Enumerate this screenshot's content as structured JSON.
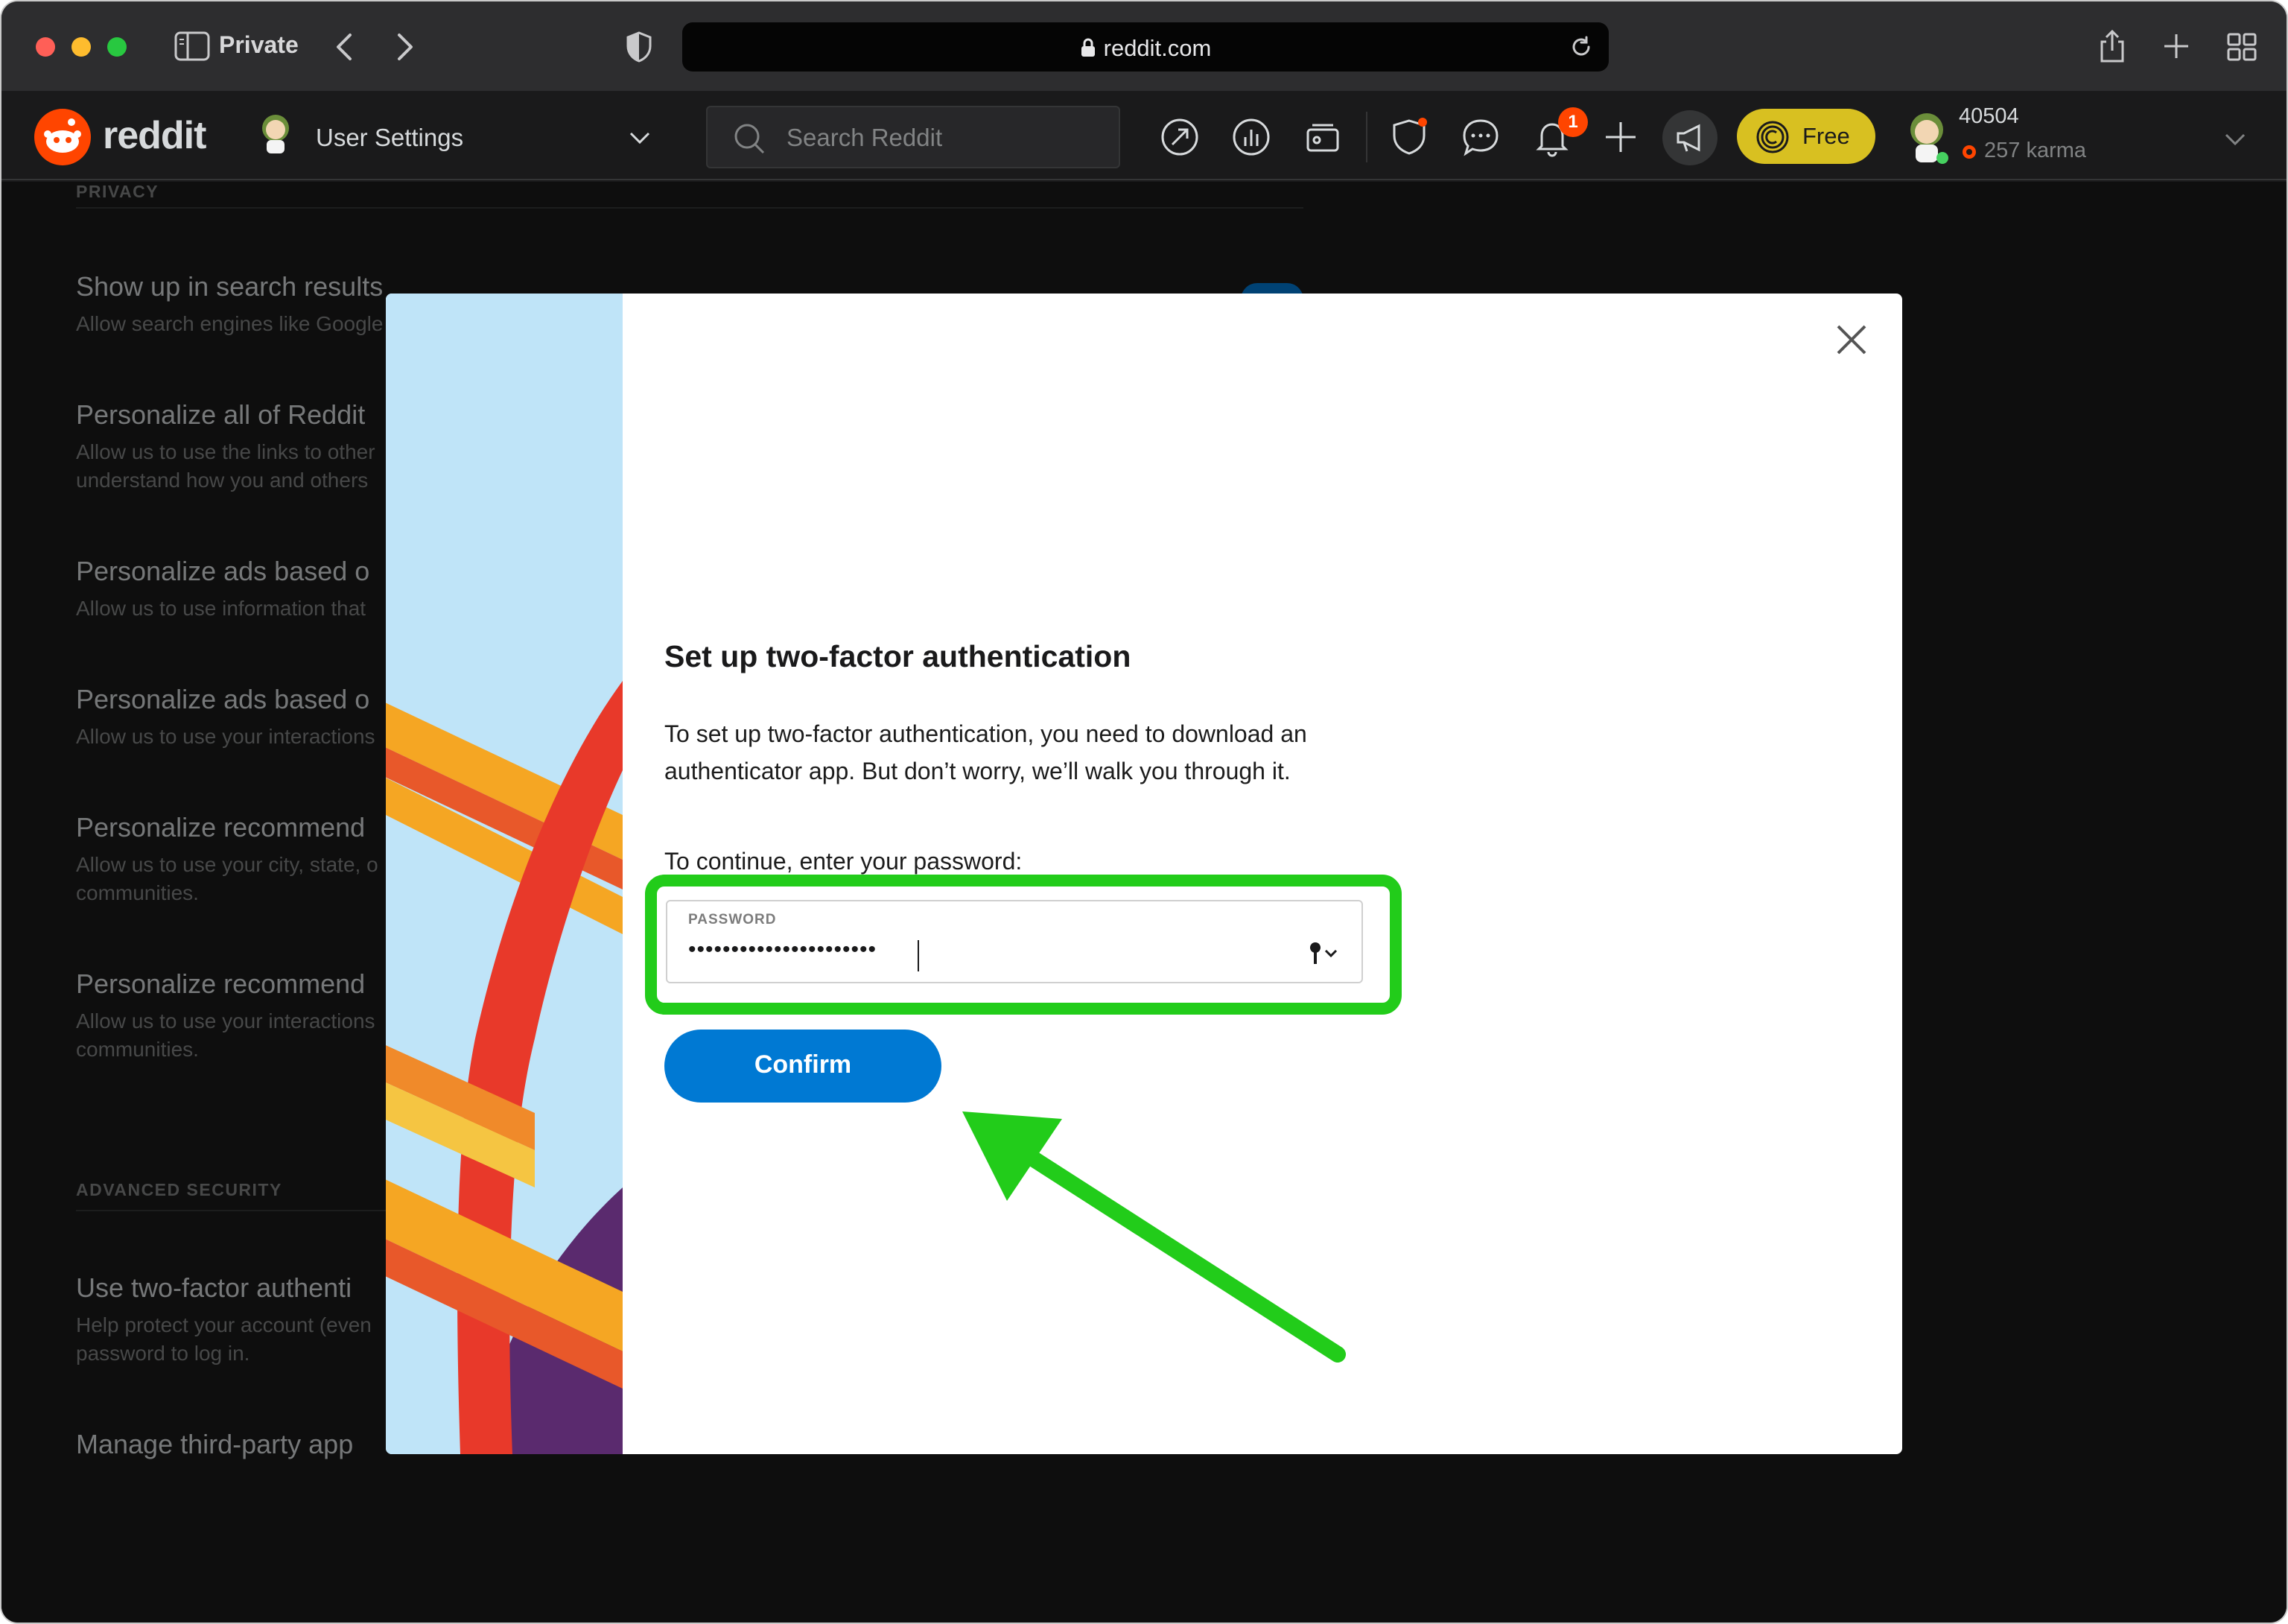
{
  "browser": {
    "private_label": "Private",
    "url": "reddit.com"
  },
  "header": {
    "logo_text": "reddit",
    "page_selector": "User Settings",
    "search_placeholder": "Search Reddit",
    "notification_count": "1",
    "premium_label": "Free",
    "username": "40504",
    "karma": "257 karma"
  },
  "settings": {
    "privacy_heading": "PRIVACY",
    "items": [
      {
        "title": "Show up in search results",
        "desc": "Allow search engines like Google"
      },
      {
        "title": "Personalize all of Reddit",
        "desc": "Allow us to use the links to other\nunderstand how you and others"
      },
      {
        "title": "Personalize ads based o",
        "desc": "Allow us to use information that"
      },
      {
        "title": "Personalize ads based o",
        "desc": "Allow us to use your interactions"
      },
      {
        "title": "Personalize recommend",
        "desc": "Allow us to use your city, state, o\ncommunities."
      },
      {
        "title": "Personalize recommend",
        "desc": "Allow us to use your interactions\ncommunities."
      }
    ],
    "security_heading": "ADVANCED SECURITY",
    "security_items": [
      {
        "title": "Use two-factor authenti",
        "desc": "Help protect your account (even\npassword to log in."
      },
      {
        "title": "Manage third-party app",
        "desc": ""
      }
    ]
  },
  "modal": {
    "title": "Set up two-factor authentication",
    "body": "To set up two-factor authentication, you need to download an authenticator app. But don’t worry, we’ll walk you through it.",
    "prompt": "To continue, enter your password:",
    "password_label": "PASSWORD",
    "password_value": "••••••••••••••••••••••",
    "confirm_label": "Confirm"
  },
  "colors": {
    "accent": "#0079d3",
    "highlight": "#22cc1a",
    "brand": "#ff4500"
  }
}
